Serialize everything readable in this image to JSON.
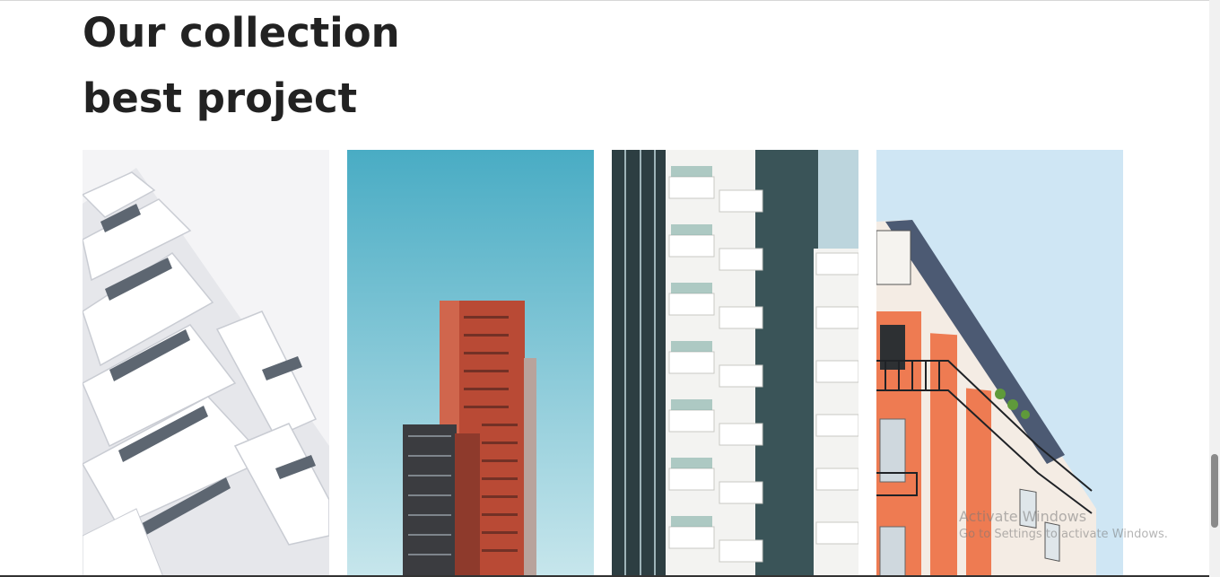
{
  "section": {
    "heading_line1": "Our collection",
    "heading_line2": "best project"
  },
  "projects": [
    {
      "image": "white-modern-building-photo"
    },
    {
      "image": "red-tower-blue-sky-photo"
    },
    {
      "image": "glass-balcony-highrise-photo"
    },
    {
      "image": "parisian-apartment-photo"
    }
  ],
  "watermark": {
    "line1": "Activate Windows",
    "line2": "Go to Settings to activate Windows."
  },
  "scrollbar": {
    "position_fraction": 0.8
  }
}
